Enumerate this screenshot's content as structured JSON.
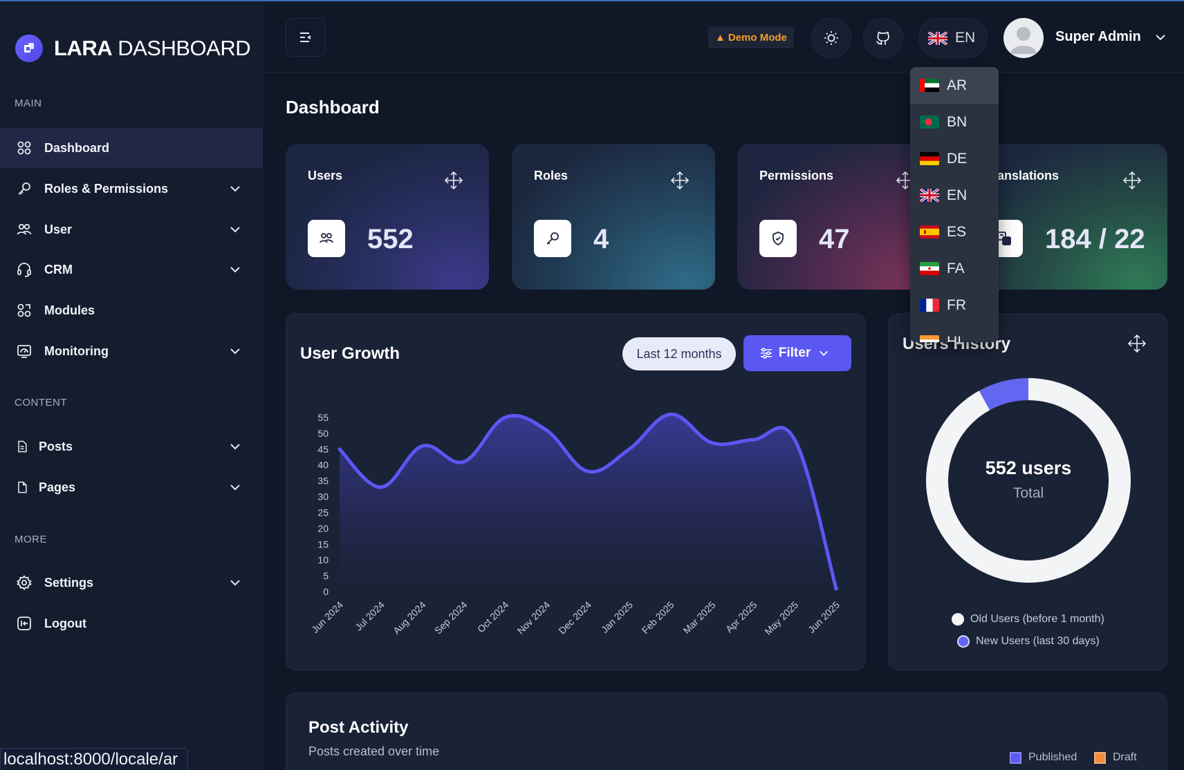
{
  "app": {
    "logo_bold": "LARA",
    "logo_light": "DASHBOARD"
  },
  "sidebar": {
    "sections": {
      "main": "MAIN",
      "content": "CONTENT",
      "more": "MORE"
    },
    "items": [
      {
        "label": "Dashboard",
        "icon": "grid-icon",
        "active": true,
        "expandable": false
      },
      {
        "label": "Roles & Permissions",
        "icon": "key-icon",
        "expandable": true
      },
      {
        "label": "User",
        "icon": "users-icon",
        "expandable": true
      },
      {
        "label": "CRM",
        "icon": "headset-icon",
        "expandable": true
      },
      {
        "label": "Modules",
        "icon": "modules-icon",
        "expandable": false
      },
      {
        "label": "Monitoring",
        "icon": "monitor-icon",
        "expandable": true
      },
      {
        "label": "Posts",
        "icon": "document-icon",
        "expandable": true
      },
      {
        "label": "Pages",
        "icon": "page-icon",
        "expandable": true
      },
      {
        "label": "Settings",
        "icon": "gear-icon",
        "expandable": true
      },
      {
        "label": "Logout",
        "icon": "logout-icon",
        "expandable": false
      }
    ]
  },
  "topbar": {
    "demo_mode": "Demo Mode",
    "language": "EN",
    "user_name": "Super Admin"
  },
  "language_menu": {
    "options": [
      "AR",
      "BN",
      "DE",
      "EN",
      "ES",
      "FA",
      "FR",
      "HI"
    ],
    "hovered": "AR"
  },
  "page": {
    "title": "Dashboard"
  },
  "stats": [
    {
      "label": "Users",
      "value": "552",
      "icon": "users-icon"
    },
    {
      "label": "Roles",
      "value": "4",
      "icon": "key-icon"
    },
    {
      "label": "Permissions",
      "value": "47",
      "icon": "shield-icon"
    },
    {
      "label": "Translations",
      "value": "184 / 22",
      "icon": "translate-icon"
    }
  ],
  "user_growth": {
    "title": "User Growth",
    "period": "Last 12 months",
    "filter_label": "Filter"
  },
  "users_history": {
    "title": "Users History",
    "center_value": "552 users",
    "center_label": "Total",
    "legend": [
      "Old Users (before 1 month)",
      "New Users (last 30 days)"
    ],
    "colors": {
      "old": "#f3f4f6",
      "new": "#6366f1"
    }
  },
  "post_activity": {
    "title": "Post Activity",
    "subtitle": "Posts created over time",
    "legend": [
      "Published",
      "Draft"
    ],
    "colors": {
      "published": "#5b57f2",
      "draft": "#f08c3e"
    }
  },
  "status_bar": {
    "url": "localhost:8000/locale/ar"
  },
  "chart_data": [
    {
      "type": "area",
      "title": "User Growth",
      "categories": [
        "Jun 2024",
        "Jul 2024",
        "Aug 2024",
        "Sep 2024",
        "Oct 2024",
        "Nov 2024",
        "Dec 2024",
        "Jan 2025",
        "Feb 2025",
        "Mar 2025",
        "Apr 2025",
        "May 2025",
        "Jun 2025"
      ],
      "series": [
        {
          "values": [
            45,
            33,
            46,
            41,
            55,
            51,
            38,
            45,
            56,
            47,
            48,
            48,
            1
          ]
        }
      ],
      "yticks": [
        0,
        5,
        10,
        15,
        20,
        25,
        30,
        35,
        40,
        45,
        50,
        55
      ],
      "ylim": [
        0,
        55
      ],
      "color": "#5b57f2"
    },
    {
      "type": "pie",
      "title": "Users History",
      "labels": [
        "Old Users (before 1 month)",
        "New Users (last 30 days)"
      ],
      "values": [
        92,
        8
      ],
      "colors": [
        "#f3f4f6",
        "#6366f1"
      ]
    }
  ]
}
